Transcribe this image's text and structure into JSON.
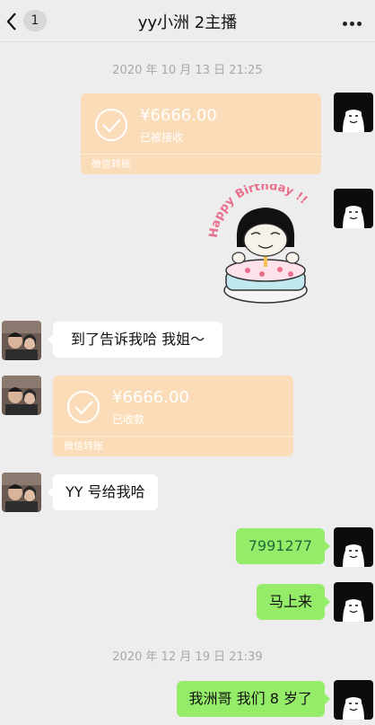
{
  "header": {
    "back_count": "1",
    "title": "yy小洲 2主播"
  },
  "timestamps": [
    "2020 年 10 月 13 日 21:25",
    "2020 年 12 月 19 日 21:39"
  ],
  "messages": {
    "transfer_1": {
      "amount": "¥6666.00",
      "status": "已被接收",
      "footer": "微信转账"
    },
    "sticker_text": "Happy Birthday !!",
    "text_1": "到了告诉我哈 我姐～",
    "transfer_2": {
      "amount": "¥6666.00",
      "status": "已收款",
      "footer": "微信转账"
    },
    "text_2": "YY 号给我哈",
    "text_3": "7991277",
    "text_4": "马上来",
    "text_5": "我洲哥 我们 8 岁了"
  },
  "colors": {
    "bg": "#ededed",
    "transfer": "#fbdcb8",
    "sent": "#95ec69",
    "received": "#ffffff"
  }
}
